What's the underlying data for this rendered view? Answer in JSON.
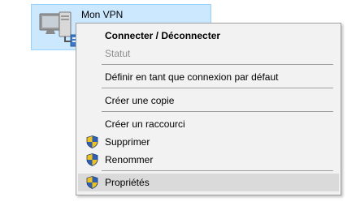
{
  "connection": {
    "label": "Mon VPN",
    "icon": "vpn-computer-icon"
  },
  "menu": {
    "items": [
      {
        "label": "Connecter / Déconnecter",
        "style": "bold"
      },
      {
        "label": "Statut",
        "style": "disabled"
      },
      {
        "label": "Définir en tant que connexion par défaut"
      },
      {
        "label": "Créer une copie"
      },
      {
        "label": "Créer un raccourci"
      },
      {
        "label": "Supprimer",
        "icon": "uac-shield-icon"
      },
      {
        "label": "Renommer",
        "icon": "uac-shield-icon"
      },
      {
        "label": "Propriétés",
        "icon": "uac-shield-icon",
        "state": "highlighted"
      }
    ]
  },
  "colors": {
    "selection_fill": "#cce8ff",
    "selection_border": "#99d1ff",
    "menu_background": "#f2f2f2",
    "menu_hover": "#dadada",
    "disabled_text": "#8d8d8d"
  }
}
